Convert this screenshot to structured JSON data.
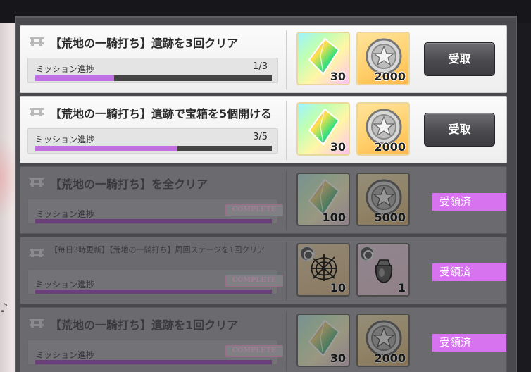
{
  "missions": [
    {
      "state": "active",
      "title": "【荒地の一騎打ち】遺跡を3回クリア",
      "progress_label": "ミッション進捗",
      "progress_text": "1/3",
      "progress_fraction": 0.333,
      "rewards": [
        {
          "icon": "rainbow-crystal-icon",
          "qty": "30"
        },
        {
          "icon": "silver-coin-icon",
          "qty": "2000"
        }
      ],
      "action_label": "受取"
    },
    {
      "state": "active",
      "title": "【荒地の一騎打ち】遺跡で宝箱を5個開ける",
      "progress_label": "ミッション進捗",
      "progress_text": "3/5",
      "progress_fraction": 0.6,
      "rewards": [
        {
          "icon": "rainbow-crystal-icon",
          "qty": "30"
        },
        {
          "icon": "silver-coin-icon",
          "qty": "2000"
        }
      ],
      "action_label": "受取"
    },
    {
      "state": "claimed",
      "title": "【荒地の一騎打ち】を全クリア",
      "progress_label": "ミッション進捗",
      "complete_label": "COMPLETE",
      "progress_fraction": 1.0,
      "rewards": [
        {
          "icon": "rainbow-crystal-icon",
          "qty": "100"
        },
        {
          "icon": "silver-coin-icon",
          "qty": "5000"
        }
      ],
      "status_label": "受領済"
    },
    {
      "state": "claimed",
      "title": "【毎日3時更新】【荒地の一騎打ち】周回ステージを1回クリア",
      "progress_label": "ミッション進捗",
      "complete_label": "COMPLETE",
      "progress_fraction": 1.0,
      "rewards": [
        {
          "icon": "spider-web-item-icon",
          "qty": "10"
        },
        {
          "icon": "pouch-item-icon",
          "qty": "1"
        }
      ],
      "status_label": "受領済"
    },
    {
      "state": "claimed",
      "title": "【荒地の一騎打ち】遺跡を1回クリア",
      "progress_label": "ミッション進捗",
      "complete_label": "COMPLETE",
      "progress_fraction": 1.0,
      "rewards": [
        {
          "icon": "rainbow-crystal-icon",
          "qty": "30"
        },
        {
          "icon": "silver-coin-icon",
          "qty": "2000"
        }
      ],
      "status_label": "受領済"
    }
  ],
  "colors": {
    "progress_fill": "#c070e0",
    "claimed_tag": "#d873f0",
    "claim_button": "#4b4a4e"
  }
}
